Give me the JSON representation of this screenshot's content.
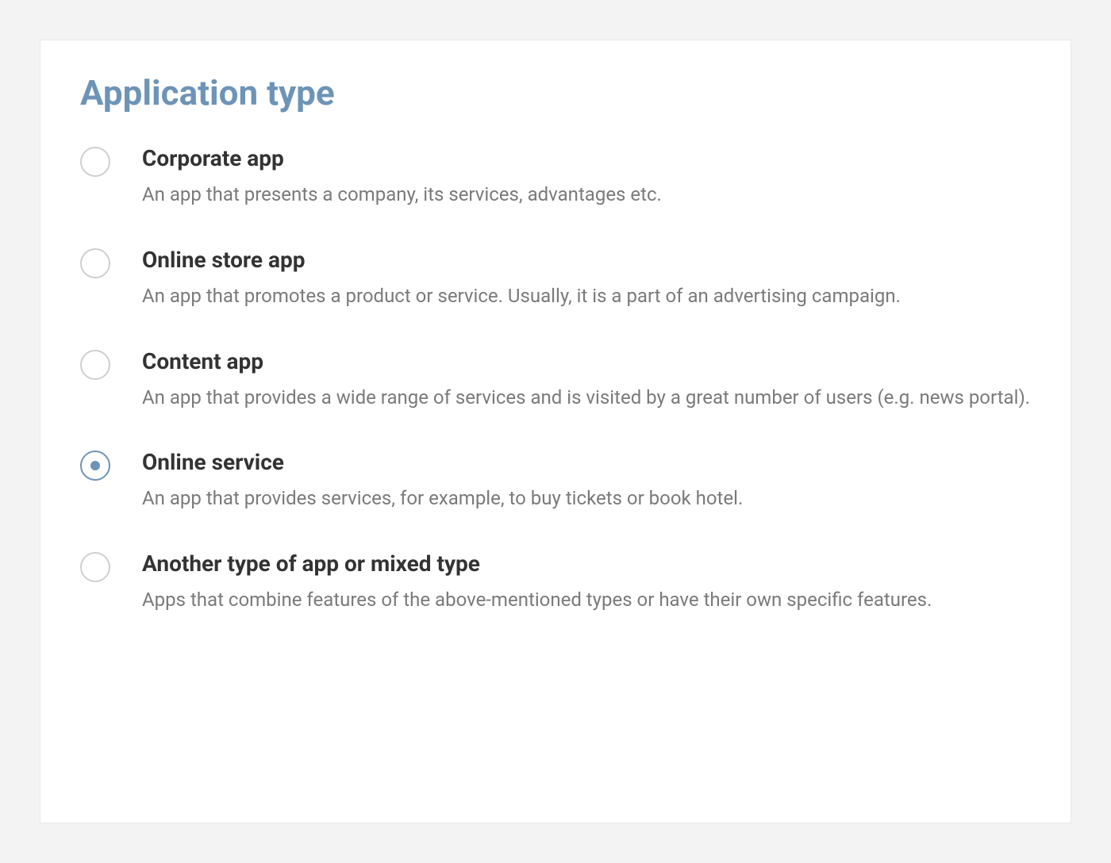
{
  "title": "Application type",
  "options": [
    {
      "title": "Corporate app",
      "description": "An app that presents a company, its services, advantages etc.",
      "selected": false
    },
    {
      "title": "Online store app",
      "description": "An app that promotes a product or service. Usually, it is a part of an advertising campaign.",
      "selected": false
    },
    {
      "title": "Content app",
      "description": "An app that provides a wide range of services and is visited by a great number of users (e.g. news portal).",
      "selected": false
    },
    {
      "title": "Online service",
      "description": "An app that provides services, for example, to buy tickets or book hotel.",
      "selected": true
    },
    {
      "title": "Another type of app or mixed type",
      "description": "Apps that combine features of the above-mentioned types or have their own specific features.",
      "selected": false
    }
  ]
}
